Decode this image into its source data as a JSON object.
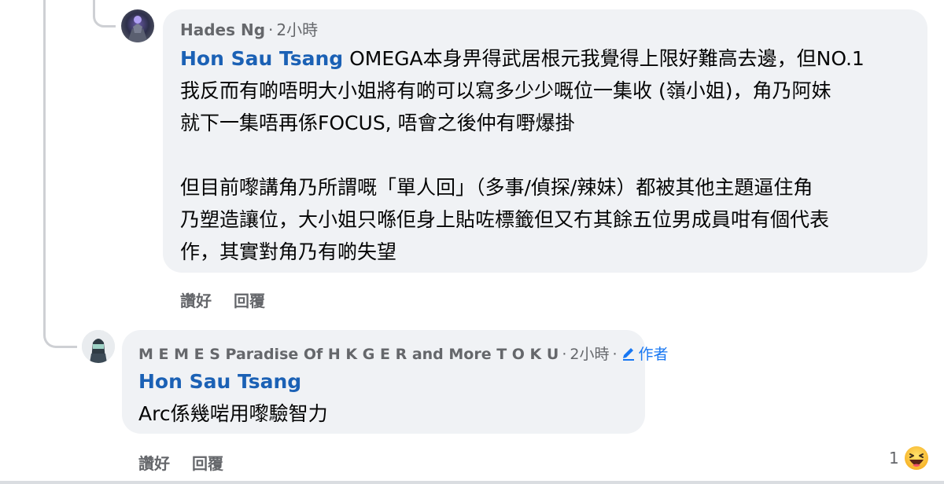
{
  "comments": [
    {
      "author": "Hades Ng",
      "time": "2小時",
      "mention": "Hon Sau Tsang",
      "line1_rest": " OMEGA本身畀得武居根元我覺得上限好難高去邊，但NO.1",
      "line2": "我反而有啲唔明大小姐將有啲可以寫多少少嘅位一集收 (嶺小姐)，角乃阿妹",
      "line3": "就下一集唔再係FOCUS, 唔會之後仲有嘢爆掛",
      "para2_line1": "但目前嚟講角乃所謂嘅「單人回」（多事/偵探/辣妹）都被其他主題逼住角",
      "para2_line2": "乃塑造讓位，大小姐只喺佢身上貼咗標籤但又冇其餘五位男成員咁有個代表",
      "para2_line3": "作，其實對角乃有啲失望",
      "like_label": "讚好",
      "reply_label": "回覆"
    },
    {
      "author": "M E M E S Paradise Of H K G E R and More T O K U",
      "time": "2小時",
      "author_tag": "作者",
      "mention": "Hon Sau Tsang",
      "text": "Arc係幾啱用嚟驗智力",
      "like_label": "讚好",
      "reply_label": "回覆",
      "reaction_count": "1",
      "reaction_icon": "haha-emoji-icon"
    }
  ],
  "separator": "·"
}
